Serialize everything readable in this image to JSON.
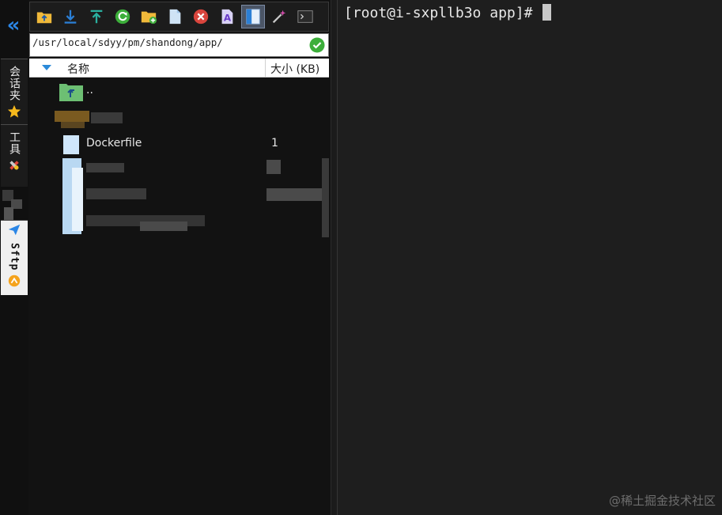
{
  "vstrip": {
    "collapse_glyph": "«",
    "tabs": [
      {
        "label": "会话夹",
        "icon": "star-icon"
      },
      {
        "label": "工具",
        "icon": "tools-icon"
      },
      {
        "label": "Sftp",
        "icon": "sftp-icon",
        "active": true
      }
    ]
  },
  "sftp": {
    "toolbar": [
      "go-up-folder-icon",
      "download-icon",
      "upload-icon",
      "refresh-icon",
      "new-folder-icon",
      "new-file-icon",
      "delete-icon",
      "rename-icon",
      "toggle-view-icon",
      "magic-wand-icon",
      "open-terminal-icon"
    ],
    "path": "/usr/local/sdyy/pm/shandong/app/",
    "columns": {
      "name": "名称",
      "size": "大小 (KB)"
    },
    "files": [
      {
        "name": "..",
        "size": "",
        "icon": "parent-folder-icon"
      },
      {
        "name": "Dockerfile",
        "size": "1",
        "icon": "file-icon"
      }
    ]
  },
  "terminal": {
    "prompt": "[root@i-sxpllb3o app]# "
  },
  "watermark": "@稀土掘金技术社区",
  "colors": {
    "accent": "#2b86e6",
    "terminal_bg": "#1e1e1e",
    "panel_bg": "#121212"
  }
}
